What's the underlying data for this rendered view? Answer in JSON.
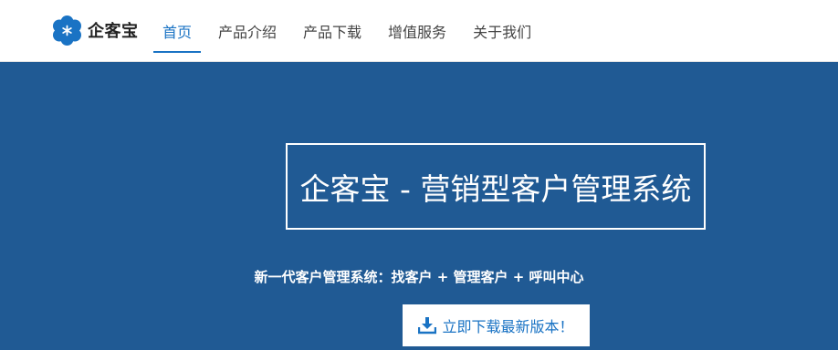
{
  "brand": {
    "name": "企客宝",
    "icon": "flower-logo-icon",
    "color": "#1a73c4"
  },
  "nav": {
    "items": [
      {
        "label": "首页",
        "active": true
      },
      {
        "label": "产品介绍",
        "active": false
      },
      {
        "label": "产品下载",
        "active": false
      },
      {
        "label": "增值服务",
        "active": false
      },
      {
        "label": "关于我们",
        "active": false
      }
    ]
  },
  "hero": {
    "background": "#205a94",
    "title": "企客宝 - 营销型客户管理系统",
    "subtitle": "新一代客户管理系统：找客户 + 管理客户 + 呼叫中心",
    "download_button": {
      "label": "立即下载最新版本！",
      "icon": "download-icon"
    }
  }
}
